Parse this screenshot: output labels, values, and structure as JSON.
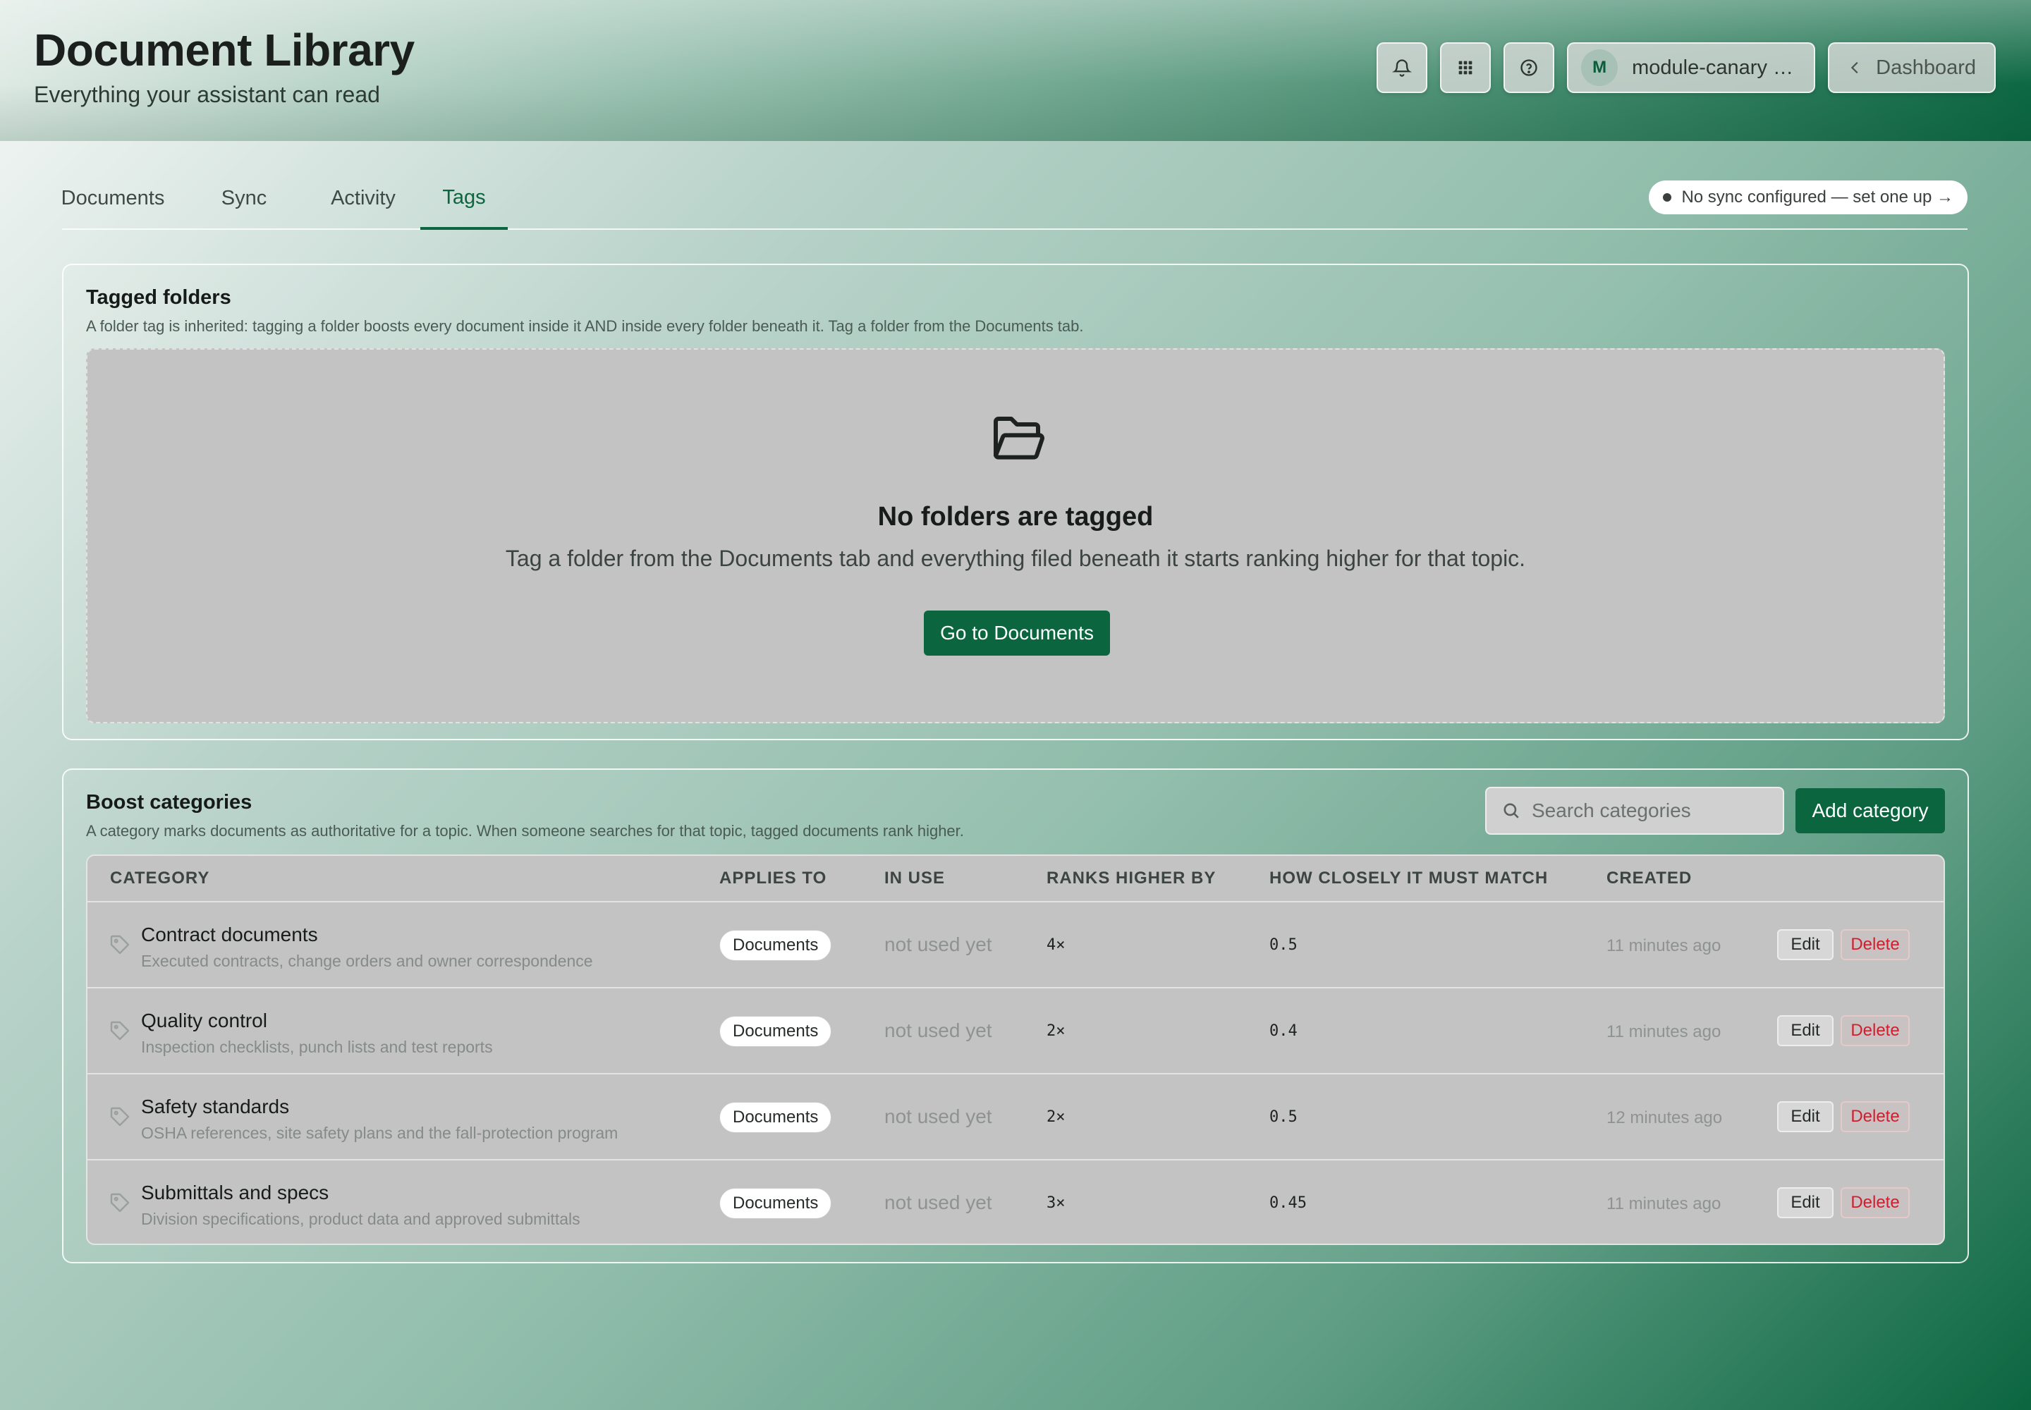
{
  "header": {
    "title": "Document Library",
    "subtitle": "Everything your assistant can read",
    "user_initial": "M",
    "user_name": "module-canary S...",
    "dashboard_label": "Dashboard",
    "icons": [
      "bell-icon",
      "grid-icon",
      "help-icon",
      "chevron-left-icon"
    ]
  },
  "tabs": [
    {
      "label": "Documents",
      "active": false
    },
    {
      "label": "Sync",
      "active": false
    },
    {
      "label": "Activity",
      "active": false
    },
    {
      "label": "Tags",
      "active": true
    }
  ],
  "sync_status": "No sync configured — set one up →",
  "tagged_folders": {
    "title": "Tagged folders",
    "description": "A folder tag is inherited: tagging a folder boosts every document inside it AND inside every folder beneath it. Tag a folder from the Documents tab.",
    "empty_title": "No folders are tagged",
    "empty_text": "Tag a folder from the Documents tab and everything filed beneath it starts ranking higher for that topic.",
    "button_label": "Go to Documents"
  },
  "boost_categories": {
    "title": "Boost categories",
    "description": "A category marks documents as authoritative for a topic. When someone searches for that topic, tagged documents rank higher.",
    "search_placeholder": "Search categories",
    "add_label": "Add category",
    "columns": [
      "CATEGORY",
      "APPLIES TO",
      "IN USE",
      "RANKS HIGHER BY",
      "HOW CLOSELY IT MUST MATCH",
      "CREATED"
    ],
    "edit_label": "Edit",
    "delete_label": "Delete",
    "rows": [
      {
        "name": "Contract documents",
        "description": "Executed contracts, change orders and owner correspondence",
        "applies_to": "Documents",
        "in_use": "not used yet",
        "boost": "4×",
        "threshold": "0.5",
        "created": "11 minutes ago"
      },
      {
        "name": "Quality control",
        "description": "Inspection checklists, punch lists and test reports",
        "applies_to": "Documents",
        "in_use": "not used yet",
        "boost": "2×",
        "threshold": "0.4",
        "created": "11 minutes ago"
      },
      {
        "name": "Safety standards",
        "description": "OSHA references, site safety plans and the fall-protection program",
        "applies_to": "Documents",
        "in_use": "not used yet",
        "boost": "2×",
        "threshold": "0.5",
        "created": "12 minutes ago"
      },
      {
        "name": "Submittals and specs",
        "description": "Division specifications, product data and approved submittals",
        "applies_to": "Documents",
        "in_use": "not used yet",
        "boost": "3×",
        "threshold": "0.45",
        "created": "11 minutes ago"
      }
    ]
  },
  "colors": {
    "accent": "#0b6640",
    "danger": "#d31d2d"
  }
}
